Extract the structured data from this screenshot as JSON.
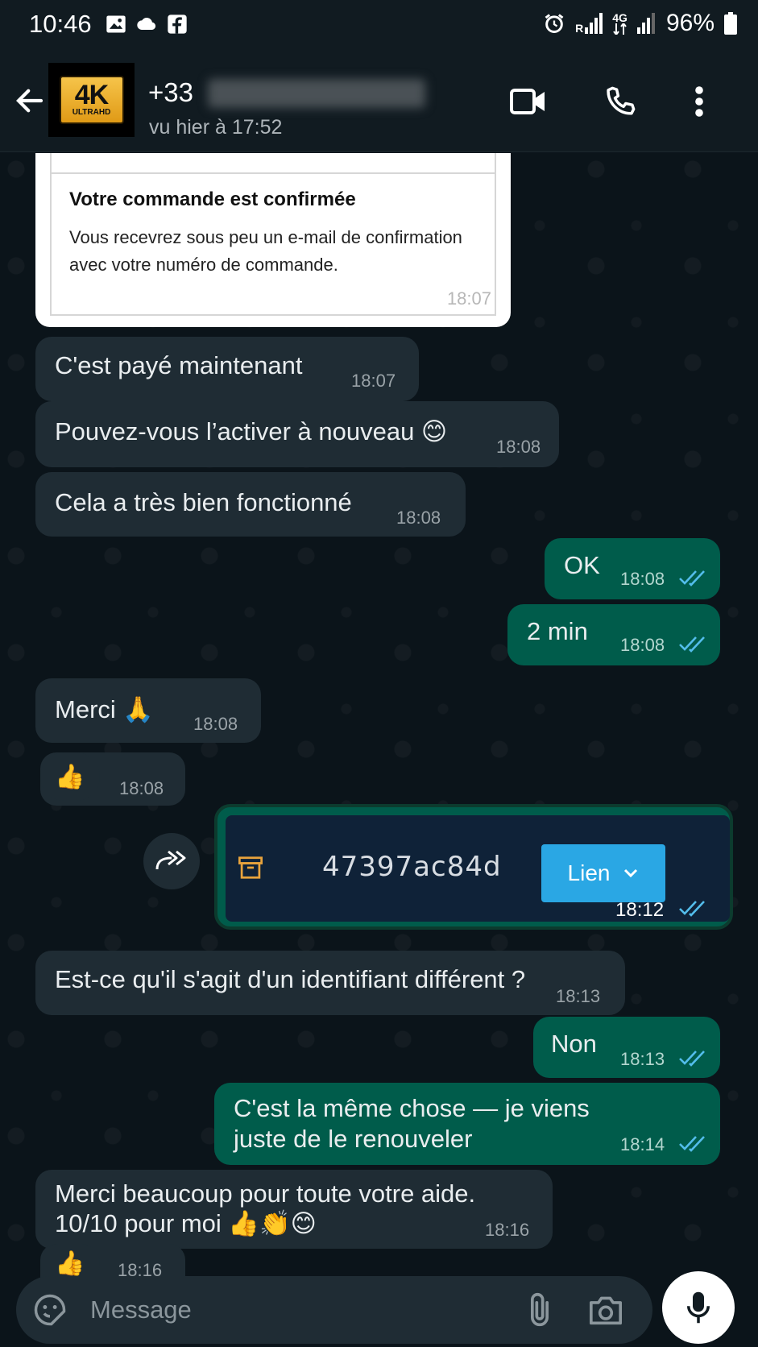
{
  "status_bar": {
    "time": "10:46",
    "battery": "96%",
    "signal_r": "R",
    "signal_4g": "4G"
  },
  "header": {
    "phone_prefix": "+33",
    "last_seen": "vu hier à 17:52",
    "avatar_text": "4K",
    "avatar_subtext": "ULTRAHD"
  },
  "messages": {
    "card_title": "Votre commande est confirmée",
    "card_text": "Vous recevrez sous peu un e-mail de confirmation avec votre numéro de commande.",
    "card_time": "18:07",
    "m1_text": "C'est payé maintenant",
    "m1_time": "18:07",
    "m2_text": "Pouvez-vous l’activer à nouveau 😊",
    "m2_time": "18:08",
    "m3_text": "Cela a très bien fonctionné",
    "m3_time": "18:08",
    "m4_text": "OK",
    "m4_time": "18:08",
    "m5_text": "2 min",
    "m5_time": "18:08",
    "m6_text": "Merci 🙏",
    "m6_time": "18:08",
    "reaction1": "👍",
    "reaction1_time": "18:08",
    "img_code": "47397ac84d",
    "img_button": "Lien",
    "img_time": "18:12",
    "m7_text": "Est-ce qu'il s'agit d'un identifiant différent ?",
    "m7_time": "18:13",
    "m8_text": "Non",
    "m8_time": "18:13",
    "m9_line1": "C'est la même chose — je viens",
    "m9_line2": "juste de le renouveler",
    "m9_time": "18:14",
    "m10_line1": "Merci beaucoup pour toute votre aide.",
    "m10_line2": "10/10 pour moi 👍👏😊",
    "m10_time": "18:16",
    "reaction2": "👍",
    "reaction2_time": "18:16"
  },
  "input": {
    "placeholder": "Message"
  },
  "colors": {
    "incoming": "#1f2c34",
    "outgoing": "#005c4b",
    "background": "#0b141a",
    "read_ticks": "#53bdeb"
  }
}
